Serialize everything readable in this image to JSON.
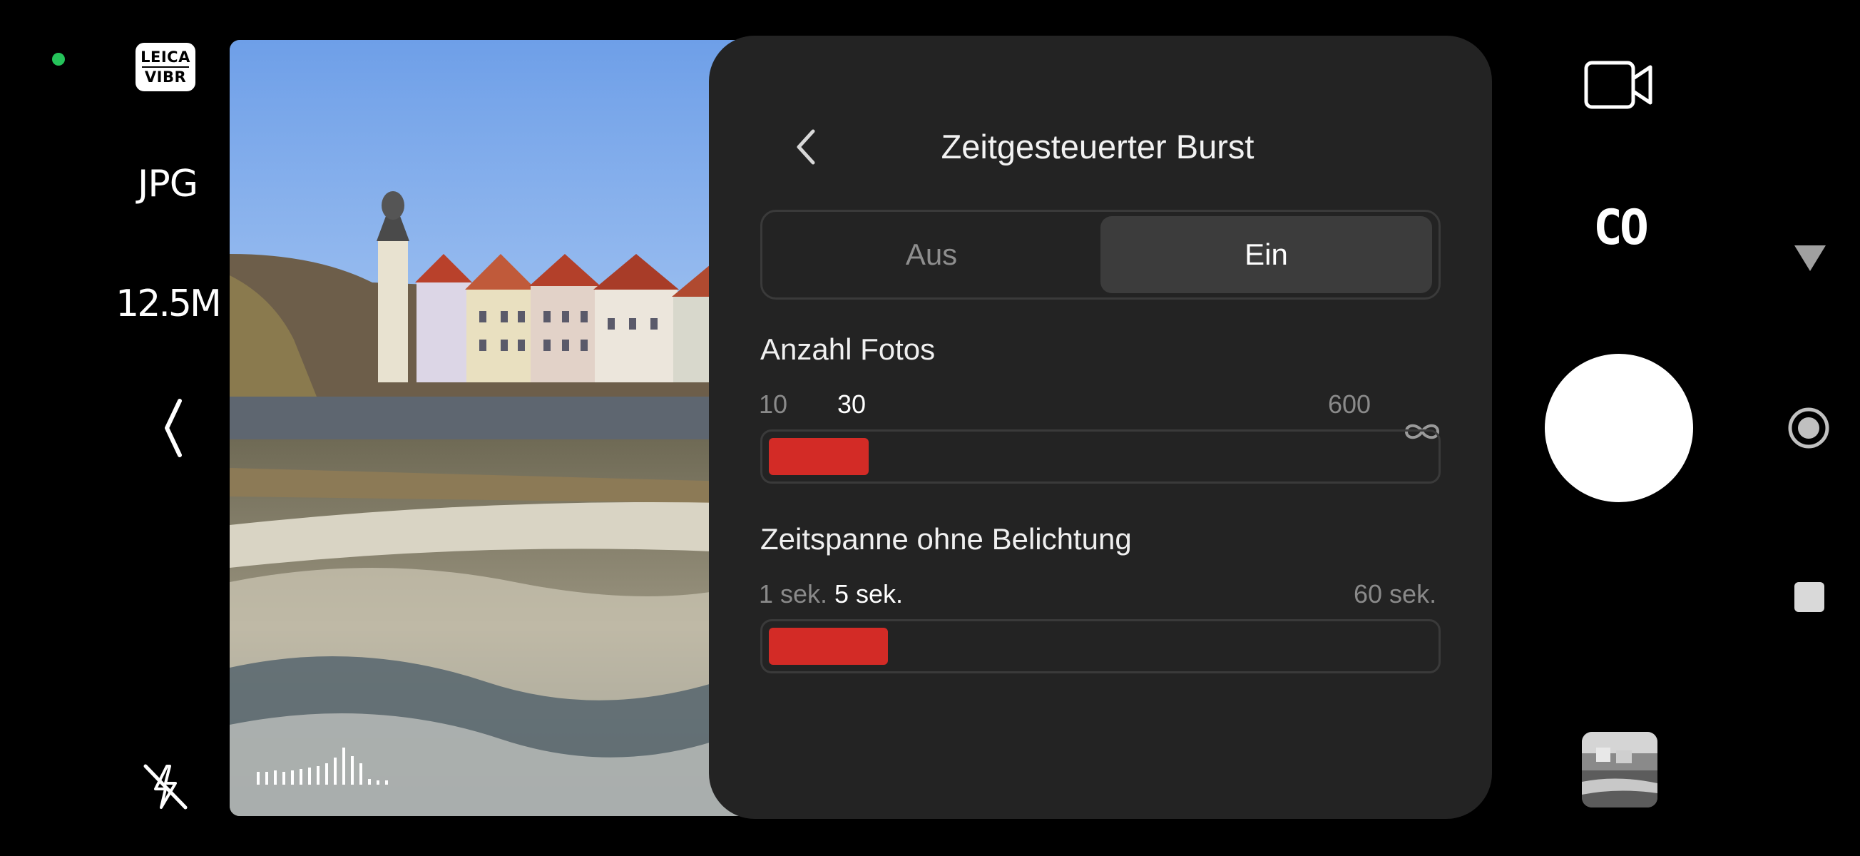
{
  "left_rail": {
    "badge_line1": "LEICA",
    "badge_line2": "VIBR",
    "format": "JPG",
    "resolution": "12.5M",
    "icons": [
      "status-dot",
      "collapse-chevron-icon",
      "flash-off-icon"
    ],
    "status_color": "#25c35a"
  },
  "panel": {
    "title": "Zeitgesteuerter Burst",
    "toggle": {
      "off_label": "Aus",
      "on_label": "Ein",
      "selected": "Ein"
    },
    "photos": {
      "label": "Anzahl Fotos",
      "min_label": "10",
      "value_label": "30",
      "max_label": "600",
      "infinity_icon": "infinity-icon",
      "value": 30,
      "fill_fraction": 0.15
    },
    "interval": {
      "label": "Zeitspanne ohne Belichtung",
      "min_label": "1 sek.",
      "value_label": "5 sek.",
      "max_label": "60 sek.",
      "value": 5,
      "fill_fraction": 0.18
    },
    "colors": {
      "panel_bg": "#232323",
      "accent": "#d32b26",
      "segment_active": "#3c3c3c"
    }
  },
  "right_controls": {
    "style_label": "CO",
    "icons": [
      "video-camera-icon",
      "triangle-down-icon",
      "shutter-button",
      "radio-target-icon",
      "stop-square-icon",
      "gallery-thumbnail"
    ]
  }
}
